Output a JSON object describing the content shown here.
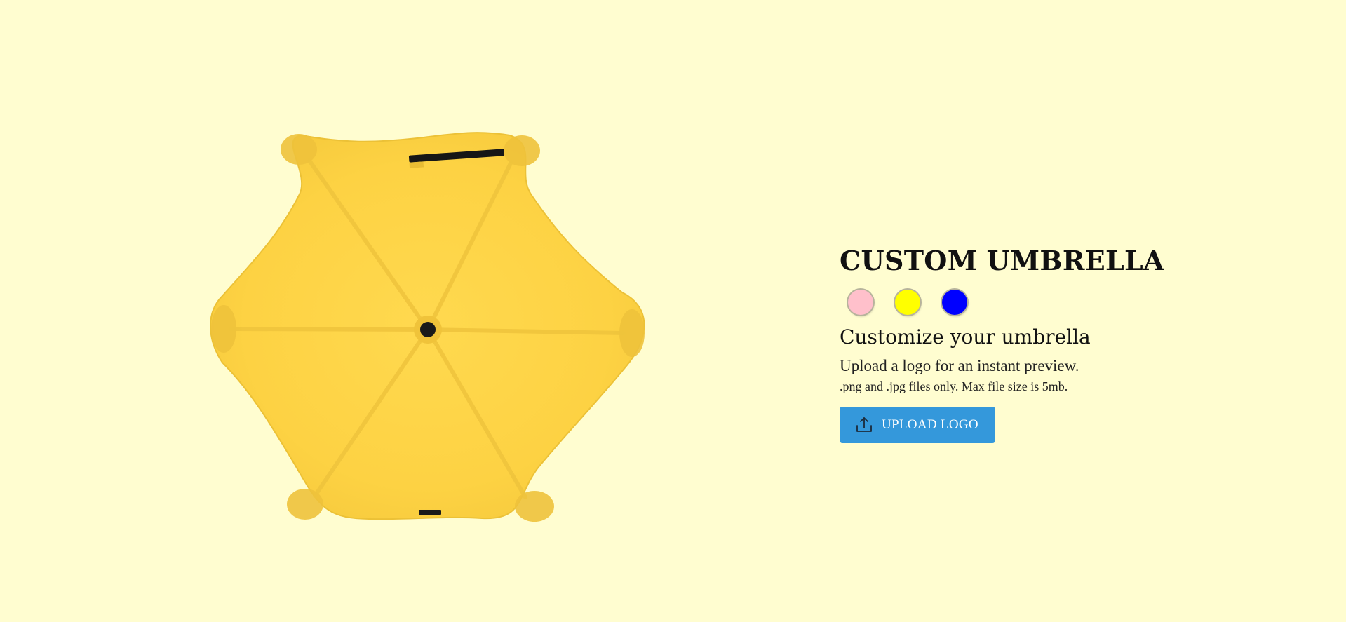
{
  "product": {
    "title": "CUSTOM UMBRELLA"
  },
  "colors": {
    "background": "#FFFDD0",
    "umbrella_canopy": "#FDD243",
    "umbrella_edge": "#F0C23A",
    "button": "#3498db"
  },
  "swatches": [
    {
      "name": "pink",
      "color": "#FFC0CB"
    },
    {
      "name": "yellow",
      "color": "#FFFF00"
    },
    {
      "name": "blue",
      "color": "#0000FF"
    }
  ],
  "customize": {
    "heading": "Customize your umbrella",
    "description": "Upload a logo for an instant preview.",
    "note": ".png and .jpg files only. Max file size is 5mb."
  },
  "upload": {
    "label": "UPLOAD LOGO",
    "icon": "upload-icon"
  },
  "umbrella": {
    "icon": "umbrella-top-view-image"
  }
}
